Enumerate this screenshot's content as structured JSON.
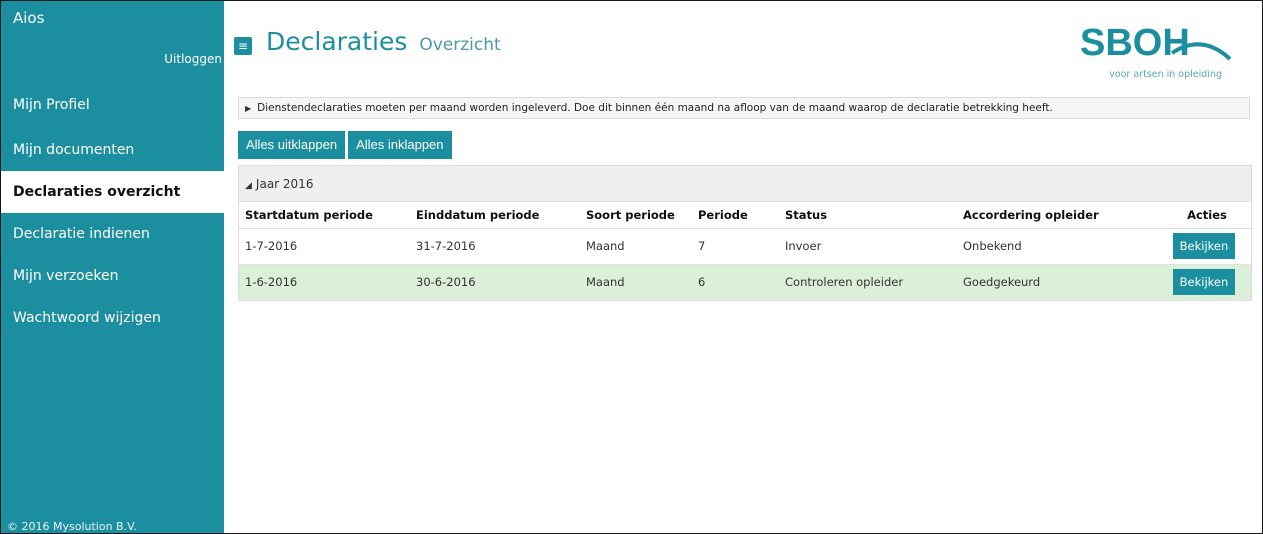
{
  "sidebar": {
    "app_name": "Aios",
    "logout": "Uitloggen",
    "items": [
      {
        "label": "Mijn Profiel"
      },
      {
        "label": "Mijn documenten"
      },
      {
        "label": "Declaraties overzicht",
        "active": true
      },
      {
        "label": "Declaratie indienen"
      },
      {
        "label": "Mijn verzoeken"
      },
      {
        "label": "Wachtwoord wijzigen"
      }
    ],
    "copyright": "© 2016 Mysolution B.V."
  },
  "header": {
    "menu_icon": "≡",
    "title": "Declaraties",
    "subtitle": "Overzicht",
    "logo_text": "SBOH",
    "logo_tagline": "voor artsen in opleiding"
  },
  "info_bar": {
    "text": "Dienstendeclaraties moeten per maand worden ingeleverd. Doe dit binnen één maand na afloop van de maand waarop de declaratie betrekking heeft."
  },
  "buttons": {
    "expand_all": "Alles uitklappen",
    "collapse_all": "Alles inklappen"
  },
  "year_group": {
    "label": "Jaar 2016"
  },
  "table": {
    "columns": [
      "Startdatum periode",
      "Einddatum periode",
      "Soort periode",
      "Periode",
      "Status",
      "Accordering opleider",
      "Acties"
    ],
    "rows": [
      {
        "start": "1-7-2016",
        "end": "31-7-2016",
        "type": "Maand",
        "period": "7",
        "status": "Invoer",
        "approval": "Onbekend",
        "action": "Bekijken"
      },
      {
        "start": "1-6-2016",
        "end": "30-6-2016",
        "type": "Maand",
        "period": "6",
        "status": "Controleren opleider",
        "approval": "Goedgekeurd",
        "action": "Bekijken"
      }
    ]
  },
  "colors": {
    "accent": "#1b8fa0",
    "row_highlight": "#dcefd8"
  }
}
